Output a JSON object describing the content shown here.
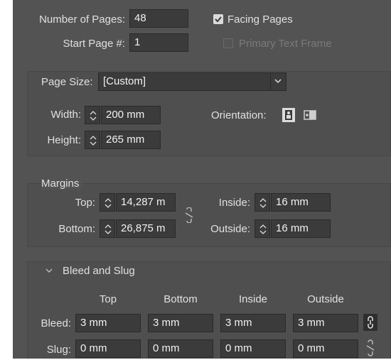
{
  "document": {
    "num_pages_label": "Number of Pages:",
    "num_pages_value": "48",
    "start_page_label": "Start Page #:",
    "start_page_value": "1",
    "facing_pages_label": "Facing Pages",
    "primary_text_frame_label": "Primary Text Frame"
  },
  "page_size": {
    "label": "Page Size:",
    "value": "[Custom]",
    "width_label": "Width:",
    "width_value": "200 mm",
    "height_label": "Height:",
    "height_value": "265 mm",
    "orientation_label": "Orientation:"
  },
  "margins": {
    "title": "Margins",
    "top_label": "Top:",
    "top_value": "14,287 m",
    "bottom_label": "Bottom:",
    "bottom_value": "26,875 m",
    "inside_label": "Inside:",
    "inside_value": "16 mm",
    "outside_label": "Outside:",
    "outside_value": "16 mm"
  },
  "bleed_slug": {
    "title": "Bleed and Slug",
    "columns": [
      "Top",
      "Bottom",
      "Inside",
      "Outside"
    ],
    "bleed_label": "Bleed:",
    "bleed_values": [
      "3 mm",
      "3 mm",
      "3 mm",
      "3 mm"
    ],
    "slug_label": "Slug:",
    "slug_values": [
      "0 mm",
      "0 mm",
      "0 mm",
      "0 mm"
    ]
  },
  "colors": {
    "panel_bg": "#535353",
    "field_bg": "#3b3b3b",
    "text": "#e0e0e0"
  }
}
